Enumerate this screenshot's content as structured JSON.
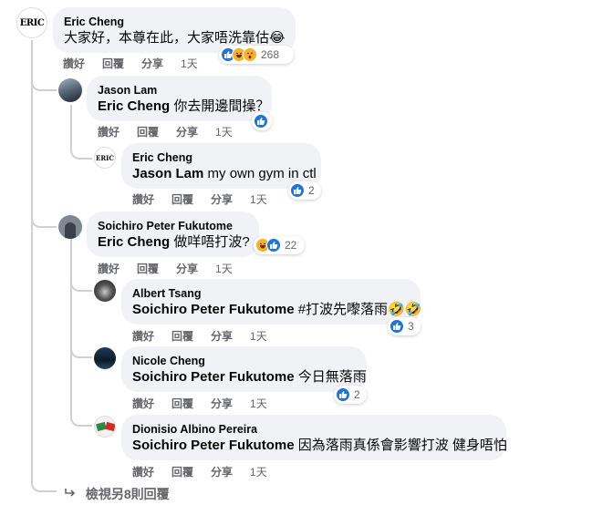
{
  "actions": {
    "like": "讚好",
    "reply": "回覆",
    "share": "分享"
  },
  "comments": [
    {
      "author": "Eric Cheng",
      "mention": "",
      "text": "大家好，本尊在此，大家唔洗靠估😂",
      "time": "1天",
      "reaction_count": "268",
      "reactions": [
        "like-icon",
        "haha-icon",
        "wow-icon"
      ]
    },
    {
      "author": "Jason Lam",
      "mention": "Eric Cheng",
      "text": " 你去開邊間操？",
      "time": "1天",
      "reaction_count": "",
      "reactions": [
        "like-icon"
      ]
    },
    {
      "author": "Eric Cheng",
      "mention": "Jason Lam",
      "text": " my own gym in ctl",
      "time": "1天",
      "reaction_count": "2",
      "reactions": [
        "like-icon"
      ]
    },
    {
      "author": "Soichiro Peter Fukutome",
      "mention": "Eric Cheng",
      "text": " 做咩唔打波?",
      "time": "1天",
      "reaction_count": "22",
      "reactions": [
        "haha-icon",
        "like-icon"
      ]
    },
    {
      "author": "Albert Tsang",
      "mention": "Soichiro Peter Fukutome",
      "text": " #打波先嚟落雨🤣🤣",
      "time": "1天",
      "reaction_count": "3",
      "reactions": [
        "like-icon"
      ]
    },
    {
      "author": "Nicole Cheng",
      "mention": "Soichiro Peter Fukutome",
      "text": " 今日無落雨",
      "time": "1天",
      "reaction_count": "2",
      "reactions": [
        "like-icon"
      ]
    },
    {
      "author": "Dionisio Albino Pereira",
      "mention": "Soichiro Peter Fukutome",
      "text": " 因為落雨真係會影響打波 健身唔怕",
      "time": "1天",
      "reaction_count": "",
      "reactions": []
    }
  ],
  "avatars": {
    "eric_logo_text": "ERIC"
  },
  "view_more": "檢視另8則回覆",
  "colors": {
    "like": "#1b74e4",
    "haha": "#f7b125",
    "bubble": "#f0f2f5",
    "secondary_text": "#65676b"
  }
}
